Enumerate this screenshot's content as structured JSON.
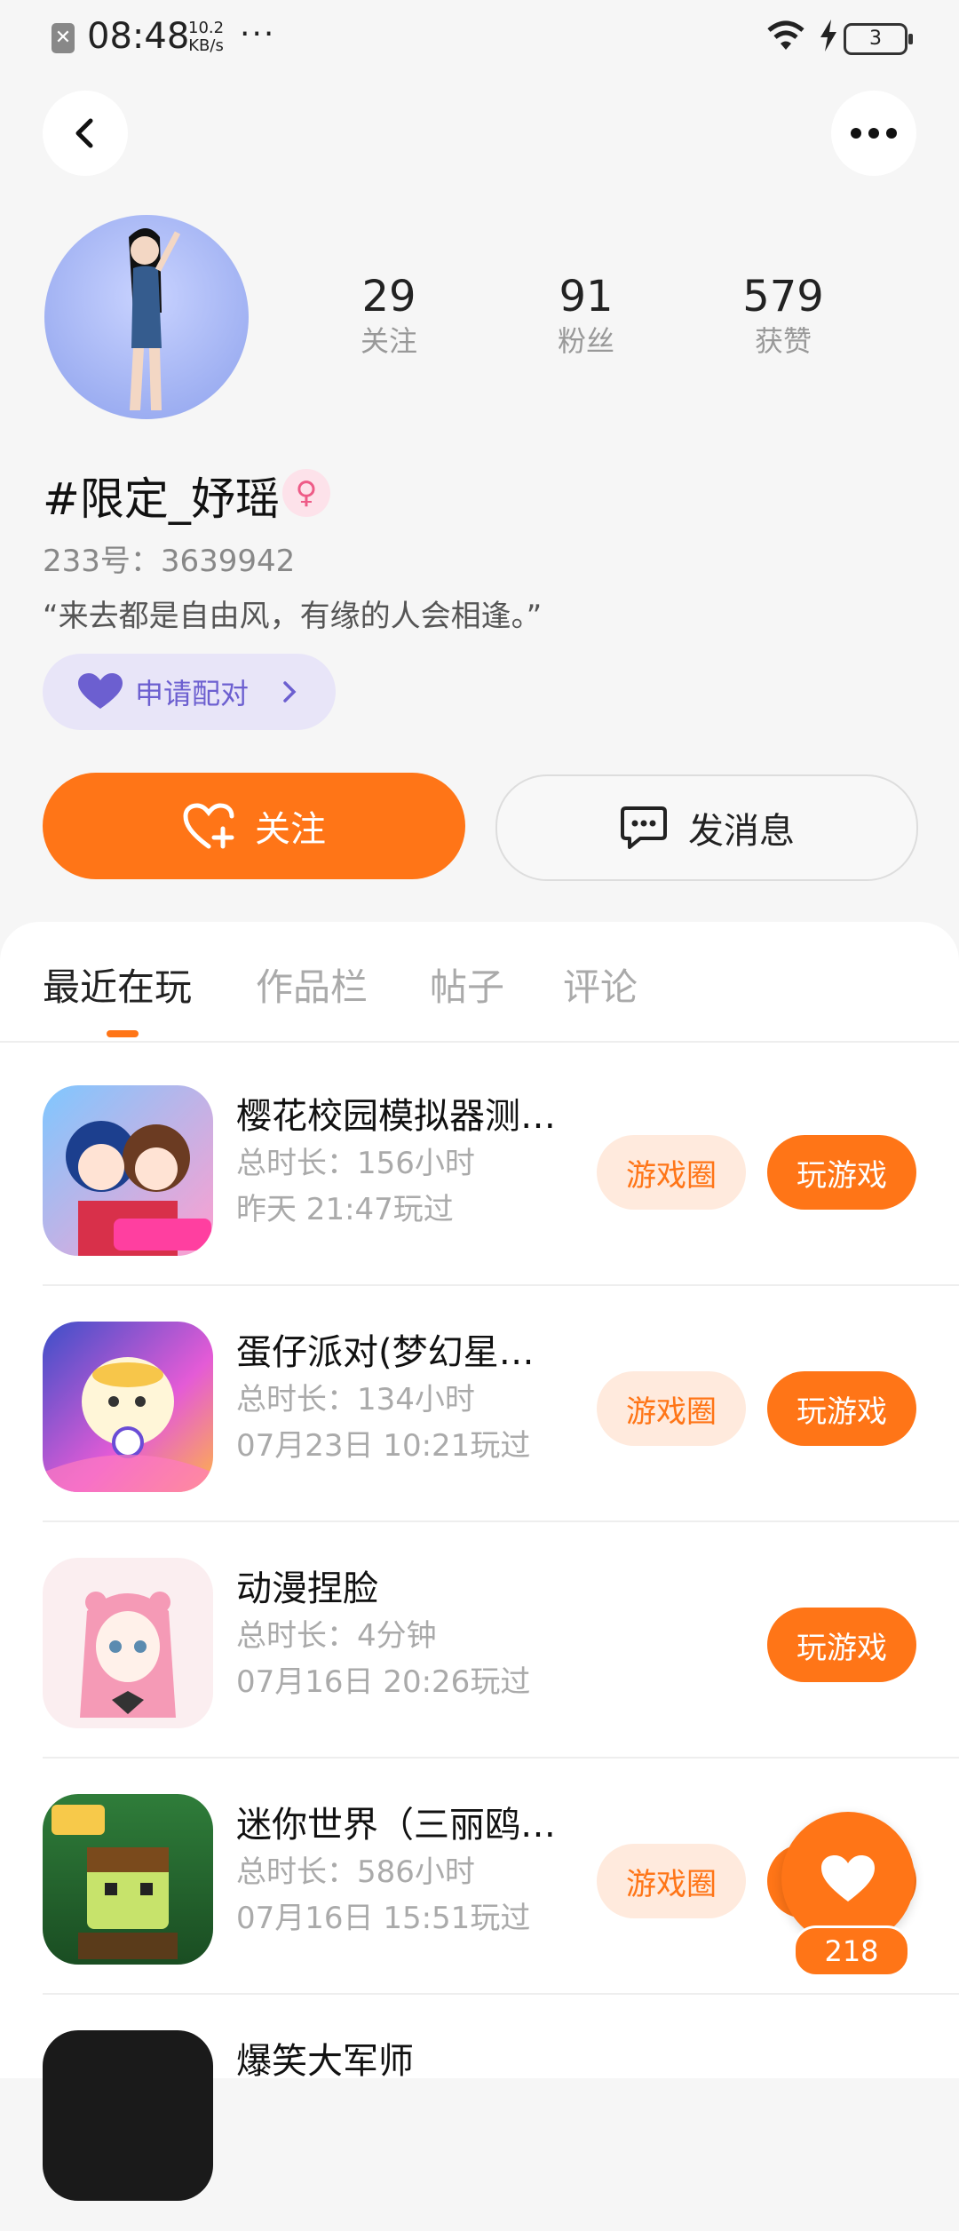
{
  "status_bar": {
    "time": "08:48",
    "speed_value": "10.2",
    "speed_unit": "KB/s",
    "more": "···",
    "battery": "3"
  },
  "profile": {
    "stats": [
      {
        "value": "29",
        "label": "关注"
      },
      {
        "value": "91",
        "label": "粉丝"
      },
      {
        "value": "579",
        "label": "获赞"
      }
    ],
    "name": "#限定_妤瑶",
    "uid": "233号：3639942",
    "bio": "“来去都是自由风，有缘的人会相逢。”",
    "pair_label": "申请配对"
  },
  "actions": {
    "follow": "关注",
    "message": "发消息"
  },
  "tabs": [
    {
      "label": "最近在玩",
      "active": true
    },
    {
      "label": "作品栏",
      "active": false
    },
    {
      "label": "帖子",
      "active": false
    },
    {
      "label": "评论",
      "active": false
    }
  ],
  "games": [
    {
      "title": "樱花校园模拟器测…",
      "duration": "总时长：156小时",
      "last_played": "昨天 21:47玩过",
      "circle_label": "游戏圈",
      "play_label": "玩游戏",
      "icon": "sakura-school-icon"
    },
    {
      "title": "蛋仔派对(梦幻星…",
      "duration": "总时长：134小时",
      "last_played": "07月23日 10:21玩过",
      "circle_label": "游戏圈",
      "play_label": "玩游戏",
      "icon": "eggy-party-icon"
    },
    {
      "title": "动漫捏脸",
      "duration": "总时长：4分钟",
      "last_played": "07月16日 20:26玩过",
      "circle_label": "",
      "play_label": "玩游戏",
      "icon": "anime-face-icon"
    },
    {
      "title": "迷你世界（三丽鸥…",
      "duration": "总时长：586小时",
      "last_played": "07月16日 15:51玩过",
      "circle_label": "游戏圈",
      "play_label": "",
      "icon": "mini-world-icon"
    },
    {
      "title": "爆笑大军师",
      "duration": "",
      "last_played": "",
      "icon": "game-icon"
    }
  ],
  "like_fab": {
    "count": "218"
  },
  "colors": {
    "accent": "#ff7517",
    "pair_bg": "#e8e5f8",
    "pair_text": "#6c5fd0"
  }
}
